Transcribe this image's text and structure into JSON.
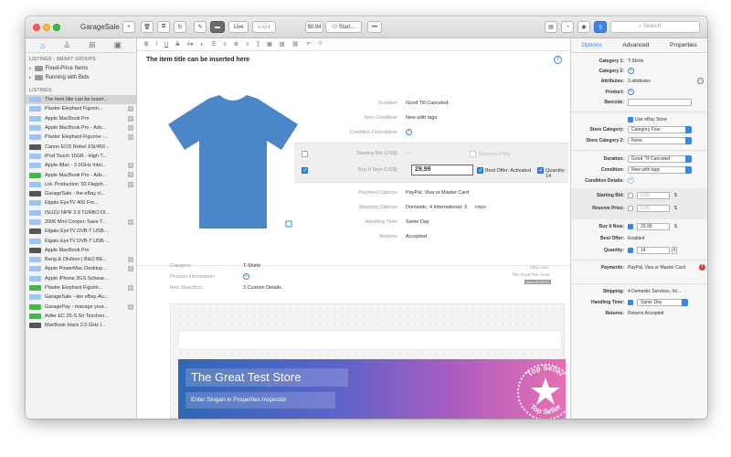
{
  "app": {
    "title": "GarageSale",
    "live_label": "Live",
    "price_label": "$0.94",
    "start_label": "Start...",
    "search_placeholder": "Search"
  },
  "sidebar": {
    "smart_head": "LISTINGS - SMART GROUPS",
    "groups": [
      "Fixed-Price Items",
      "Running with Bids"
    ],
    "list_head": "LISTINGS",
    "listings": [
      {
        "text": "The item title can be insert...",
        "badge": "b-blue",
        "count": ""
      },
      {
        "text": "Plaster Elephant Figurin...",
        "badge": "b-blue",
        "count": "8"
      },
      {
        "text": "Apple MacBook Pro",
        "badge": "b-blue",
        "count": "8"
      },
      {
        "text": "Apple MacBook Pro - Adv...",
        "badge": "b-blue",
        "count": "8"
      },
      {
        "text": "Plaster Elephant Figurine -...",
        "badge": "b-blue",
        "count": "13"
      },
      {
        "text": "Canon EOS Rebel XSi/450...",
        "badge": "b-dark",
        "count": ""
      },
      {
        "text": "iPod Touch 16GB - High T...",
        "badge": "b-blue",
        "count": ""
      },
      {
        "text": "Apple iMac - 2.0GHz Intel...",
        "badge": "b-blue",
        "count": "8"
      },
      {
        "text": "Apple MacBook Pro - Adv...",
        "badge": "b-green",
        "count": "8"
      },
      {
        "text": "Ltd. Production '93 Flagsh...",
        "badge": "b-blue",
        "count": "8"
      },
      {
        "text": "GarageSale - the eBay cl...",
        "badge": "b-dark",
        "count": ""
      },
      {
        "text": "Elgato EyeTV 400 Fre...",
        "badge": "b-blue",
        "count": ""
      },
      {
        "text": "ISUZU NPR 3.9 TURBO DI...",
        "badge": "b-blue",
        "count": ""
      },
      {
        "text": "2006 Mini Cooper, Save T...",
        "badge": "b-blue",
        "count": "8"
      },
      {
        "text": "Elgato EyeTV DVB-T USB-...",
        "badge": "b-dark",
        "count": ""
      },
      {
        "text": "Elgato EyeTV DVB-T USB-...",
        "badge": "b-blue",
        "count": ""
      },
      {
        "text": "Apple MacBook Pro",
        "badge": "b-dark",
        "count": ""
      },
      {
        "text": "Bang & Olufsen | B&O BE...",
        "badge": "b-blue",
        "count": "8"
      },
      {
        "text": "Apple PowerMac Desktop...",
        "badge": "b-blue",
        "count": "8"
      },
      {
        "text": "Apple iPhone 3GS Schwar...",
        "badge": "b-blue",
        "count": ""
      },
      {
        "text": "Plaster Elephant Figurin...",
        "badge": "b-green",
        "count": "8"
      },
      {
        "text": "GarageSale - der eBay-Au...",
        "badge": "b-blue",
        "count": ""
      },
      {
        "text": "GaragePay - manage your...",
        "badge": "b-green",
        "count": "8"
      },
      {
        "text": "Adler EC 25-S Sir Teschen...",
        "badge": "b-green",
        "count": ""
      },
      {
        "text": "MacBook black 2.0 GHz I...",
        "badge": "b-dark",
        "count": ""
      }
    ]
  },
  "editor": {
    "title": "The item title can be inserted here",
    "duration_label": "Duration:",
    "duration_value": "Good Till Canceled",
    "condition_label": "Item Condition:",
    "condition_value": "New with tags",
    "cond_desc_label": "Condition Description:",
    "starting_bid_label": "Starting Bid (US$):",
    "starting_bid_value": "—",
    "reserve_label": "Reserve Price",
    "buy_now_label": "Buy It Now (US$):",
    "buy_now_value": "29,99",
    "best_offer_label": "Best Offer: Activated",
    "quantity_label": "Quantity: 14",
    "payment_label": "Payment Options:",
    "payment_value": "PayPal, Visa or Master Card",
    "shipping_label": "Shipping Options:",
    "shipping_value": "Domestic: 4  International: 3",
    "shipping_free": "FREE",
    "handling_label": "Handling Time:",
    "handling_value": "Same Day",
    "returns_label": "Returns:",
    "returns_value": "Accepted",
    "category_label": "Category:",
    "category_value": "T-Shirts",
    "product_label": "Product Information:",
    "specifics_label": "Item Specifics:",
    "specifics_value": "3 Custom Details",
    "seller_line1": "eBay User",
    "seller_line2": "The Great Test Store",
    "seller_btn": "Item #0000 ID",
    "store_title": "The Great Test Store",
    "slogan": "Enter Slogan in Properties Inspector",
    "seal_top": "Top Seller",
    "seal_bottom": "Top Seller"
  },
  "inspector": {
    "tabs": [
      "Options",
      "Advanced",
      "Properties"
    ],
    "category1_label": "Category 1:",
    "category1_value": "T-Shirts",
    "category2_label": "Category 2:",
    "attributes_label": "Attributes:",
    "attributes_value": "3 attributes",
    "product_label": "Product:",
    "barcode_label": "Barcode:",
    "use_store_label": "Use eBay Store",
    "store_cat_label": "Store Category:",
    "store_cat_value": "Category Four",
    "store_cat2_label": "Store Category 2:",
    "store_cat2_value": "None",
    "duration_label": "Duration:",
    "duration_value": "Good 'Til Canceled",
    "condition_label": "Condition:",
    "condition_value": "New with tags",
    "cond_details_label": "Condition Details:",
    "starting_bid_label": "Starting Bid:",
    "starting_bid_value": "0.00",
    "reserve_label": "Reserve Price:",
    "reserve_value": "0.00",
    "currency": "$",
    "buy_now_label": "Buy It Now:",
    "buy_now_value": "29.99",
    "best_offer_label": "Best Offer:",
    "best_offer_value": "Enabled",
    "quantity_label": "Quantity:",
    "quantity_value": "14",
    "payments_label": "Payments:",
    "payments_value": "PayPal, Visa or Master Card",
    "shipping_label": "Shipping:",
    "shipping_value": "4 Domestic Services, Int...",
    "handling_label": "Handling Time:",
    "handling_value": "Same Day",
    "returns_label": "Returns:",
    "returns_value": "Returns Accepted"
  },
  "colors": {
    "accent": "#3a86e0",
    "shirt": "#4a86c8",
    "warning": "#e23b3b"
  }
}
